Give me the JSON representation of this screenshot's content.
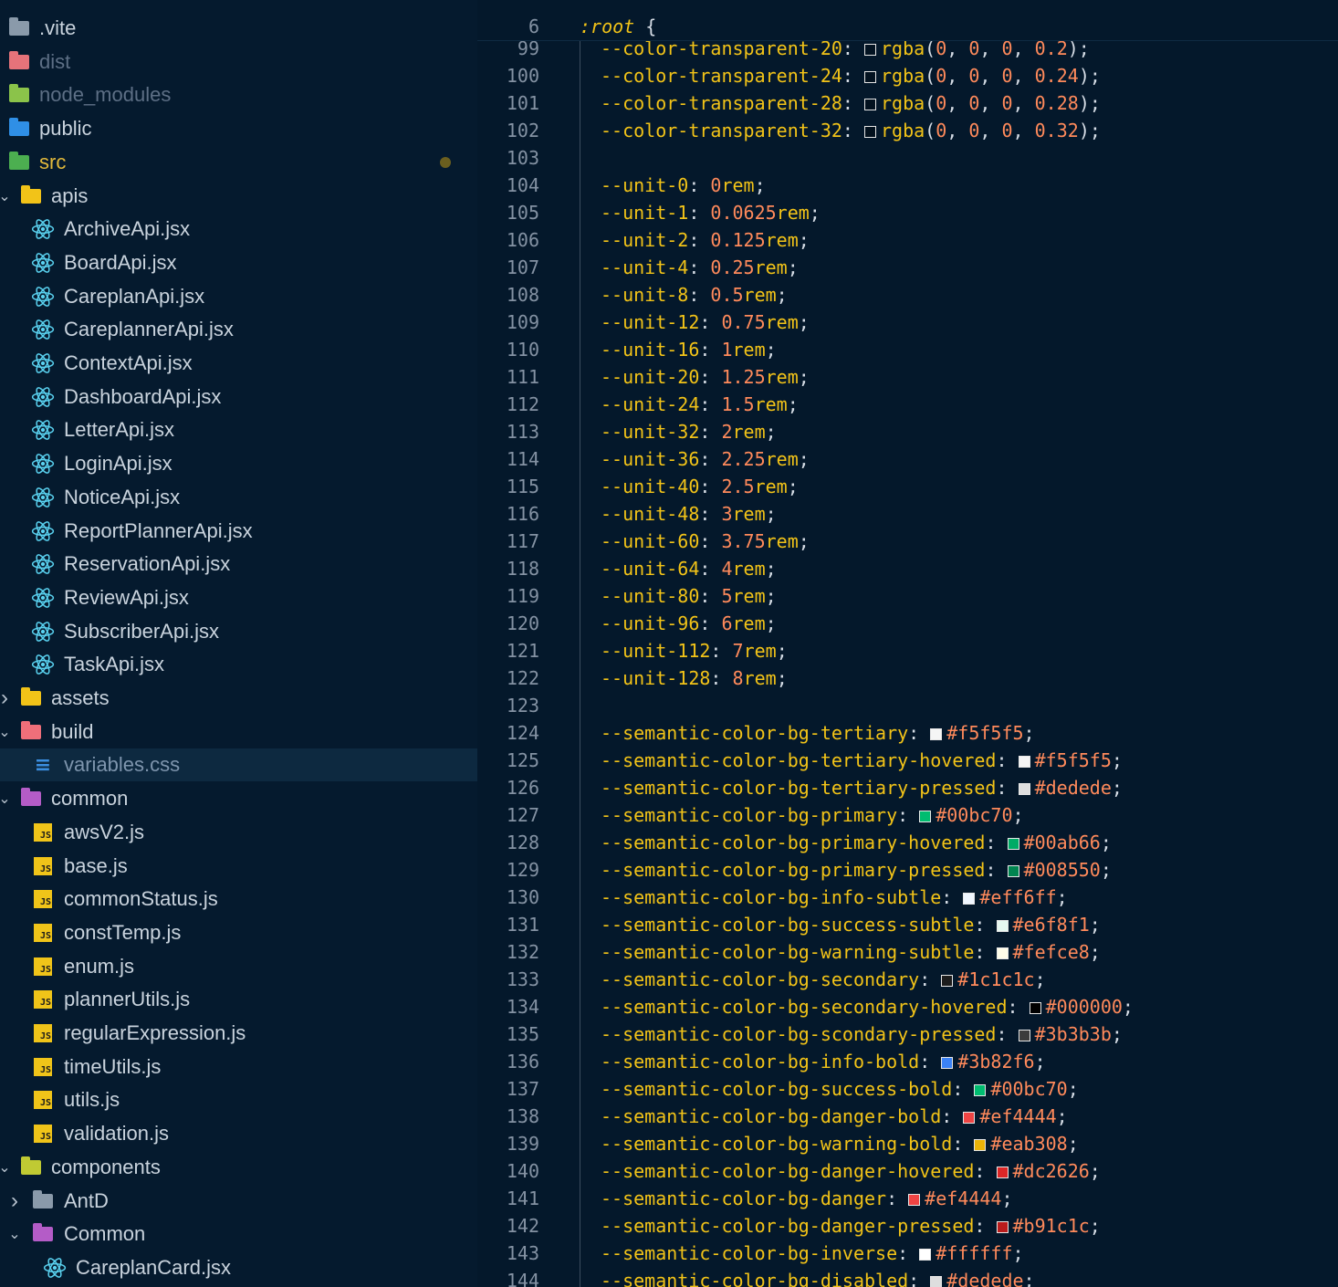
{
  "sidebar": {
    "items": [
      {
        "label": ".vite",
        "depth": 0,
        "icon": "folder-gray",
        "style": "normal"
      },
      {
        "label": "dist",
        "depth": 0,
        "icon": "folder-red",
        "style": "dim"
      },
      {
        "label": "node_modules",
        "depth": 0,
        "icon": "folder-green",
        "style": "dim"
      },
      {
        "label": "public",
        "depth": 0,
        "icon": "folder-blue",
        "style": "normal"
      },
      {
        "label": "src",
        "depth": 0,
        "icon": "folder-src",
        "style": "src",
        "modified": true
      },
      {
        "label": "apis",
        "depth": 1,
        "icon": "folder-yellow",
        "style": "normal",
        "chevron": "open"
      },
      {
        "label": "ArchiveApi.jsx",
        "depth": 2,
        "icon": "react",
        "style": "normal"
      },
      {
        "label": "BoardApi.jsx",
        "depth": 2,
        "icon": "react",
        "style": "normal"
      },
      {
        "label": "CareplanApi.jsx",
        "depth": 2,
        "icon": "react",
        "style": "normal"
      },
      {
        "label": "CareplannerApi.jsx",
        "depth": 2,
        "icon": "react",
        "style": "normal"
      },
      {
        "label": "ContextApi.jsx",
        "depth": 2,
        "icon": "react",
        "style": "normal"
      },
      {
        "label": "DashboardApi.jsx",
        "depth": 2,
        "icon": "react",
        "style": "normal"
      },
      {
        "label": "LetterApi.jsx",
        "depth": 2,
        "icon": "react",
        "style": "normal"
      },
      {
        "label": "LoginApi.jsx",
        "depth": 2,
        "icon": "react",
        "style": "normal"
      },
      {
        "label": "NoticeApi.jsx",
        "depth": 2,
        "icon": "react",
        "style": "normal"
      },
      {
        "label": "ReportPlannerApi.jsx",
        "depth": 2,
        "icon": "react",
        "style": "normal"
      },
      {
        "label": "ReservationApi.jsx",
        "depth": 2,
        "icon": "react",
        "style": "normal"
      },
      {
        "label": "ReviewApi.jsx",
        "depth": 2,
        "icon": "react",
        "style": "normal"
      },
      {
        "label": "SubscriberApi.jsx",
        "depth": 2,
        "icon": "react",
        "style": "normal"
      },
      {
        "label": "TaskApi.jsx",
        "depth": 2,
        "icon": "react",
        "style": "normal"
      },
      {
        "label": "assets",
        "depth": 1,
        "icon": "folder-yellow",
        "style": "normal",
        "chevron": "closed"
      },
      {
        "label": "build",
        "depth": 1,
        "icon": "folder-pink",
        "style": "normal",
        "chevron": "open"
      },
      {
        "label": "variables.css",
        "depth": 2,
        "icon": "css",
        "style": "selected"
      },
      {
        "label": "common",
        "depth": 1,
        "icon": "folder-purple",
        "style": "normal",
        "chevron": "open"
      },
      {
        "label": "awsV2.js",
        "depth": 2,
        "icon": "js",
        "style": "normal"
      },
      {
        "label": "base.js",
        "depth": 2,
        "icon": "js",
        "style": "normal"
      },
      {
        "label": "commonStatus.js",
        "depth": 2,
        "icon": "js",
        "style": "normal"
      },
      {
        "label": "constTemp.js",
        "depth": 2,
        "icon": "js",
        "style": "normal"
      },
      {
        "label": "enum.js",
        "depth": 2,
        "icon": "js",
        "style": "normal"
      },
      {
        "label": "plannerUtils.js",
        "depth": 2,
        "icon": "js",
        "style": "normal"
      },
      {
        "label": "regularExpression.js",
        "depth": 2,
        "icon": "js",
        "style": "normal"
      },
      {
        "label": "timeUtils.js",
        "depth": 2,
        "icon": "js",
        "style": "normal"
      },
      {
        "label": "utils.js",
        "depth": 2,
        "icon": "js",
        "style": "normal"
      },
      {
        "label": "validation.js",
        "depth": 2,
        "icon": "js",
        "style": "normal"
      },
      {
        "label": "components",
        "depth": 1,
        "icon": "folder-lime",
        "style": "normal",
        "chevron": "open"
      },
      {
        "label": "AntD",
        "depth": 2,
        "icon": "folder-gray",
        "style": "normal",
        "chevron": "closed"
      },
      {
        "label": "Common",
        "depth": 2,
        "icon": "folder-purple",
        "style": "normal",
        "chevron": "open"
      },
      {
        "label": "CareplanCard.jsx",
        "depth": 3,
        "icon": "react",
        "style": "normal"
      }
    ]
  },
  "editor": {
    "sticky": {
      "line": "6",
      "selector": ":root",
      "brace": " {"
    },
    "lines": [
      {
        "n": "99",
        "prop": "--color-transparent-20",
        "kind": "rgba",
        "args": [
          "0",
          "0",
          "0",
          "0.2"
        ],
        "swatch": "rgba(0,0,0,0.2)"
      },
      {
        "n": "100",
        "prop": "--color-transparent-24",
        "kind": "rgba",
        "args": [
          "0",
          "0",
          "0",
          "0.24"
        ],
        "swatch": "rgba(0,0,0,0.24)"
      },
      {
        "n": "101",
        "prop": "--color-transparent-28",
        "kind": "rgba",
        "args": [
          "0",
          "0",
          "0",
          "0.28"
        ],
        "swatch": "rgba(0,0,0,0.28)"
      },
      {
        "n": "102",
        "prop": "--color-transparent-32",
        "kind": "rgba",
        "args": [
          "0",
          "0",
          "0",
          "0.32"
        ],
        "swatch": "rgba(0,0,0,0.32)"
      },
      {
        "n": "103",
        "kind": "blank"
      },
      {
        "n": "104",
        "prop": "--unit-0",
        "kind": "rem",
        "value": "0"
      },
      {
        "n": "105",
        "prop": "--unit-1",
        "kind": "rem",
        "value": "0.0625"
      },
      {
        "n": "106",
        "prop": "--unit-2",
        "kind": "rem",
        "value": "0.125"
      },
      {
        "n": "107",
        "prop": "--unit-4",
        "kind": "rem",
        "value": "0.25"
      },
      {
        "n": "108",
        "prop": "--unit-8",
        "kind": "rem",
        "value": "0.5"
      },
      {
        "n": "109",
        "prop": "--unit-12",
        "kind": "rem",
        "value": "0.75"
      },
      {
        "n": "110",
        "prop": "--unit-16",
        "kind": "rem",
        "value": "1"
      },
      {
        "n": "111",
        "prop": "--unit-20",
        "kind": "rem",
        "value": "1.25"
      },
      {
        "n": "112",
        "prop": "--unit-24",
        "kind": "rem",
        "value": "1.5"
      },
      {
        "n": "113",
        "prop": "--unit-32",
        "kind": "rem",
        "value": "2"
      },
      {
        "n": "114",
        "prop": "--unit-36",
        "kind": "rem",
        "value": "2.25"
      },
      {
        "n": "115",
        "prop": "--unit-40",
        "kind": "rem",
        "value": "2.5"
      },
      {
        "n": "116",
        "prop": "--unit-48",
        "kind": "rem",
        "value": "3"
      },
      {
        "n": "117",
        "prop": "--unit-60",
        "kind": "rem",
        "value": "3.75"
      },
      {
        "n": "118",
        "prop": "--unit-64",
        "kind": "rem",
        "value": "4"
      },
      {
        "n": "119",
        "prop": "--unit-80",
        "kind": "rem",
        "value": "5"
      },
      {
        "n": "120",
        "prop": "--unit-96",
        "kind": "rem",
        "value": "6"
      },
      {
        "n": "121",
        "prop": "--unit-112",
        "kind": "rem",
        "value": "7"
      },
      {
        "n": "122",
        "prop": "--unit-128",
        "kind": "rem",
        "value": "8"
      },
      {
        "n": "123",
        "kind": "blank"
      },
      {
        "n": "124",
        "prop": "--semantic-color-bg-tertiary",
        "kind": "hex",
        "value": "#f5f5f5"
      },
      {
        "n": "125",
        "prop": "--semantic-color-bg-tertiary-hovered",
        "kind": "hex",
        "value": "#f5f5f5"
      },
      {
        "n": "126",
        "prop": "--semantic-color-bg-tertiary-pressed",
        "kind": "hex",
        "value": "#dedede"
      },
      {
        "n": "127",
        "prop": "--semantic-color-bg-primary",
        "kind": "hex",
        "value": "#00bc70"
      },
      {
        "n": "128",
        "prop": "--semantic-color-bg-primary-hovered",
        "kind": "hex",
        "value": "#00ab66"
      },
      {
        "n": "129",
        "prop": "--semantic-color-bg-primary-pressed",
        "kind": "hex",
        "value": "#008550"
      },
      {
        "n": "130",
        "prop": "--semantic-color-bg-info-subtle",
        "kind": "hex",
        "value": "#eff6ff"
      },
      {
        "n": "131",
        "prop": "--semantic-color-bg-success-subtle",
        "kind": "hex",
        "value": "#e6f8f1"
      },
      {
        "n": "132",
        "prop": "--semantic-color-bg-warning-subtle",
        "kind": "hex",
        "value": "#fefce8"
      },
      {
        "n": "133",
        "prop": "--semantic-color-bg-secondary",
        "kind": "hex",
        "value": "#1c1c1c"
      },
      {
        "n": "134",
        "prop": "--semantic-color-bg-secondary-hovered",
        "kind": "hex",
        "value": "#000000"
      },
      {
        "n": "135",
        "prop": "--semantic-color-bg-scondary-pressed",
        "kind": "hex",
        "value": "#3b3b3b"
      },
      {
        "n": "136",
        "prop": "--semantic-color-bg-info-bold",
        "kind": "hex",
        "value": "#3b82f6"
      },
      {
        "n": "137",
        "prop": "--semantic-color-bg-success-bold",
        "kind": "hex",
        "value": "#00bc70"
      },
      {
        "n": "138",
        "prop": "--semantic-color-bg-danger-bold",
        "kind": "hex",
        "value": "#ef4444"
      },
      {
        "n": "139",
        "prop": "--semantic-color-bg-warning-bold",
        "kind": "hex",
        "value": "#eab308"
      },
      {
        "n": "140",
        "prop": "--semantic-color-bg-danger-hovered",
        "kind": "hex",
        "value": "#dc2626"
      },
      {
        "n": "141",
        "prop": "--semantic-color-bg-danger",
        "kind": "hex",
        "value": "#ef4444"
      },
      {
        "n": "142",
        "prop": "--semantic-color-bg-danger-pressed",
        "kind": "hex",
        "value": "#b91c1c"
      },
      {
        "n": "143",
        "prop": "--semantic-color-bg-inverse",
        "kind": "hex",
        "value": "#ffffff"
      },
      {
        "n": "144",
        "prop": "--semantic-color-bg-disabled",
        "kind": "hex",
        "value": "#dedede"
      }
    ]
  },
  "colors": {
    "folder-gray": "#8a9aaa",
    "folder-red": "#e5737a",
    "folder-green": "#8bc34a",
    "folder-blue": "#2f8fe6",
    "folder-src": "#4caf50",
    "folder-yellow": "#f2c318",
    "folder-pink": "#ef6f7a",
    "folder-purple": "#b45cc7",
    "folder-lime": "#c0ca33",
    "react": "#5ad2f0"
  }
}
